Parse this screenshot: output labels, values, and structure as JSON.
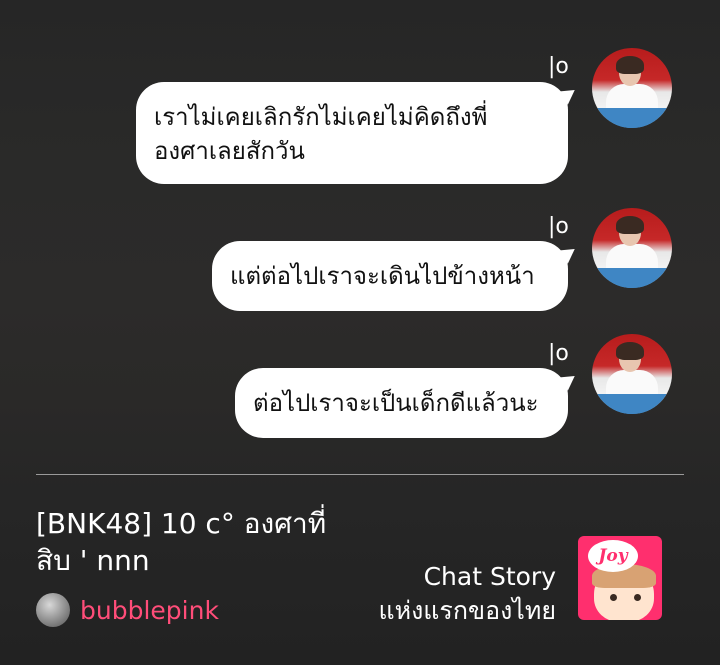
{
  "messages": [
    {
      "tag": "|o",
      "text_line1": "เราไม่เคยเลิกรักไม่เคยไม่คิดถึงพี่",
      "text_line2": "องศาเลยสักวัน"
    },
    {
      "tag": "|o",
      "text": "แต่ต่อไปเราจะเดินไปข้างหน้า"
    },
    {
      "tag": "|o",
      "text": "ต่อไปเราจะเป็นเด็กดีแล้วนะ"
    }
  ],
  "story": {
    "title_line1": "[BNK48] 10 c° องศาที่",
    "title_line2": "สิบ ' nnn",
    "author": "bubblepink"
  },
  "brand": {
    "line1": "Chat Story",
    "line2": "แห่งแรกของไทย",
    "logo_text": "Joy"
  },
  "colors": {
    "author": "#ff4d79",
    "logo_bg": "#ff2f6e",
    "bubble": "#ffffff"
  }
}
